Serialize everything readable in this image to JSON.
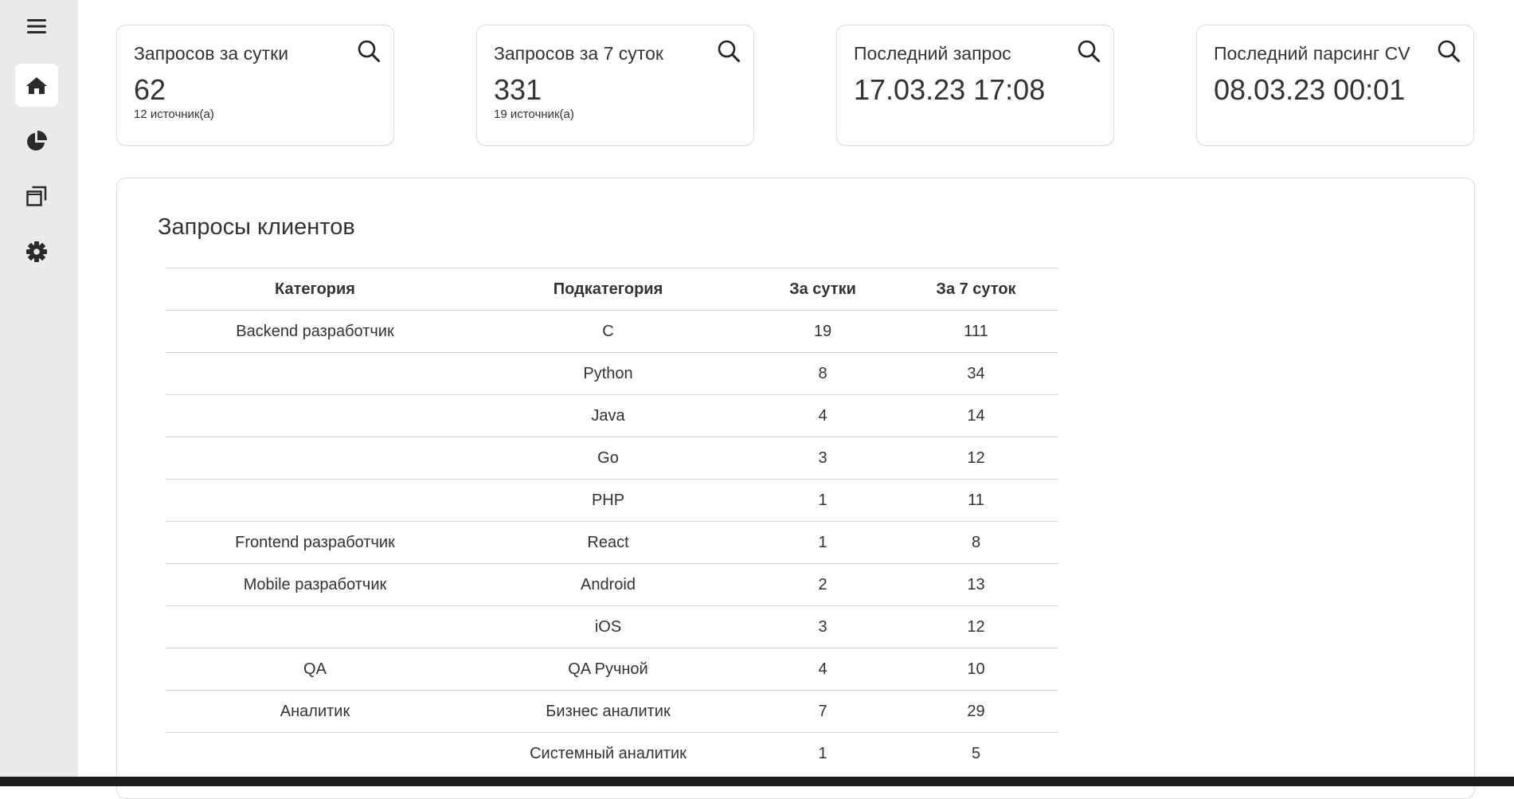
{
  "sidebar": {
    "items": [
      {
        "icon": "hamburger-menu-icon"
      },
      {
        "icon": "home-icon",
        "active": true
      },
      {
        "icon": "pie-chart-icon"
      },
      {
        "icon": "copy-windows-icon"
      },
      {
        "icon": "gear-icon"
      }
    ]
  },
  "cards": [
    {
      "title": "Запросов за сутки",
      "value": "62",
      "sub": "12 источник(а)",
      "icon": "search-icon"
    },
    {
      "title": "Запросов за 7 суток",
      "value": "331",
      "sub": "19 источник(а)",
      "icon": "search-icon"
    },
    {
      "title": "Последний запрос",
      "value": "17.03.23 17:08",
      "sub": "",
      "icon": "search-icon"
    },
    {
      "title": "Последний парсинг CV",
      "value": "08.03.23 00:01",
      "sub": "",
      "icon": "search-icon"
    }
  ],
  "requests": {
    "title": "Запросы клиентов",
    "headers": [
      "Категория",
      "Подкатегория",
      "За сутки",
      "За 7 суток"
    ],
    "rows": [
      [
        "Backend разработчик",
        "C",
        "19",
        "111"
      ],
      [
        "",
        "Python",
        "8",
        "34"
      ],
      [
        "",
        "Java",
        "4",
        "14"
      ],
      [
        "",
        "Go",
        "3",
        "12"
      ],
      [
        "",
        "PHP",
        "1",
        "11"
      ],
      [
        "Frontend разработчик",
        "React",
        "1",
        "8"
      ],
      [
        "Mobile разработчик",
        "Android",
        "2",
        "13"
      ],
      [
        "",
        "iOS",
        "3",
        "12"
      ],
      [
        "QA",
        "QA Ручной",
        "4",
        "10"
      ],
      [
        "Аналитик",
        "Бизнес аналитик",
        "7",
        "29"
      ],
      [
        "",
        "Системный аналитик",
        "1",
        "5"
      ]
    ]
  },
  "colors": {
    "sidebar_bg": "#eaeaea",
    "text": "#333333",
    "border": "#dcdcdc",
    "taskbar": "#1c1c1c"
  }
}
